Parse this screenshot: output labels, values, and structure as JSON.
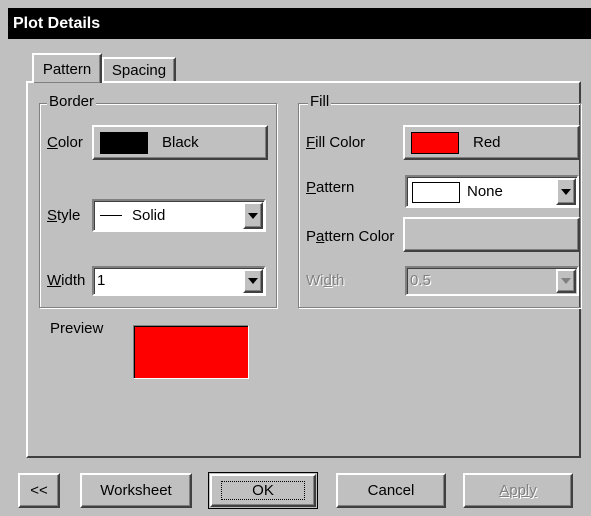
{
  "window": {
    "title": "Plot Details"
  },
  "tabs": [
    {
      "label": "Pattern",
      "active": true
    },
    {
      "label": "Spacing",
      "active": false
    }
  ],
  "border": {
    "group_label": "Border",
    "color_label": "Color",
    "color_value": "Black",
    "color_hex": "#000000",
    "style_label": "Style",
    "style_value": "Solid",
    "width_label": "Width",
    "width_value": "1"
  },
  "fill": {
    "group_label": "Fill",
    "fill_color_label": "Fill Color",
    "fill_color_value": "Red",
    "fill_color_hex": "#ff0000",
    "pattern_label": "Pattern",
    "pattern_value": "None",
    "pattern_color_label": "Pattern Color",
    "width_label": "Width",
    "width_value": "0.5"
  },
  "preview": {
    "label": "Preview",
    "color_hex": "#ff0000"
  },
  "buttons": {
    "collapse_label": "<<",
    "worksheet_label": "Worksheet",
    "ok_label": "OK",
    "cancel_label": "Cancel",
    "apply_label": "Apply"
  }
}
